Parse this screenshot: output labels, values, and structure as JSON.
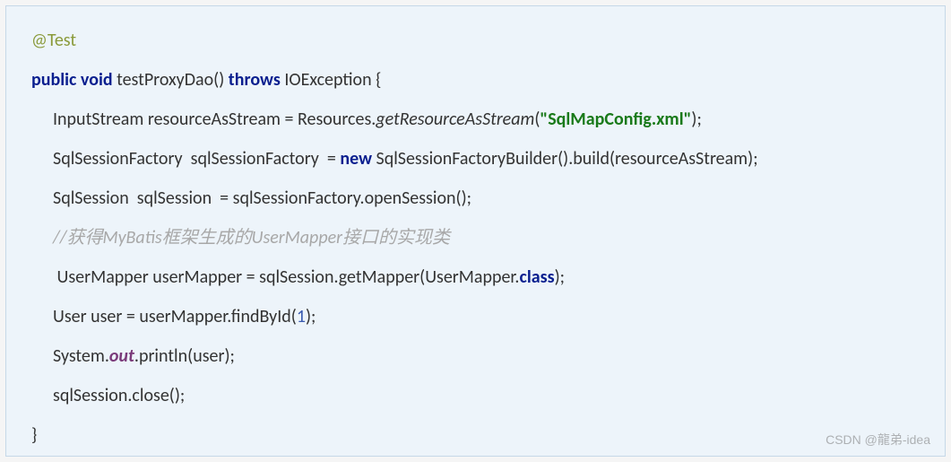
{
  "code": {
    "annotation": "@Test",
    "public_void": "public void",
    "method_name": " testProxyDao() ",
    "throws": "throws",
    "exception": " IOException {",
    "line1_pre": "InputStream resourceAsStream = Resources.",
    "line1_method": "getResourceAsStream",
    "line1_open": "(",
    "line1_string": "\"SqlMapConfig.xml\"",
    "line1_close": ");",
    "line2_pre": "SqlSessionFactory  sqlSessionFactory  = ",
    "line2_new": "new",
    "line2_post": " SqlSessionFactoryBuilder().build(resourceAsStream);",
    "line3": "SqlSession  sqlSession  = sqlSessionFactory.openSession();",
    "comment": "//获得MyBatis框架生成的UserMapper接口的实现类",
    "line4_pre": " UserMapper userMapper = sqlSession.getMapper(UserMapper.",
    "line4_class": "class",
    "line4_close": ");",
    "line5_pre": "User user = userMapper.findById(",
    "line5_num": "1",
    "line5_close": ");",
    "line6_pre": "System.",
    "line6_out": "out",
    "line6_post": ".println(user);",
    "line7": "sqlSession.close();",
    "close_brace": "}"
  },
  "watermark": "CSDN @龍弟-idea"
}
